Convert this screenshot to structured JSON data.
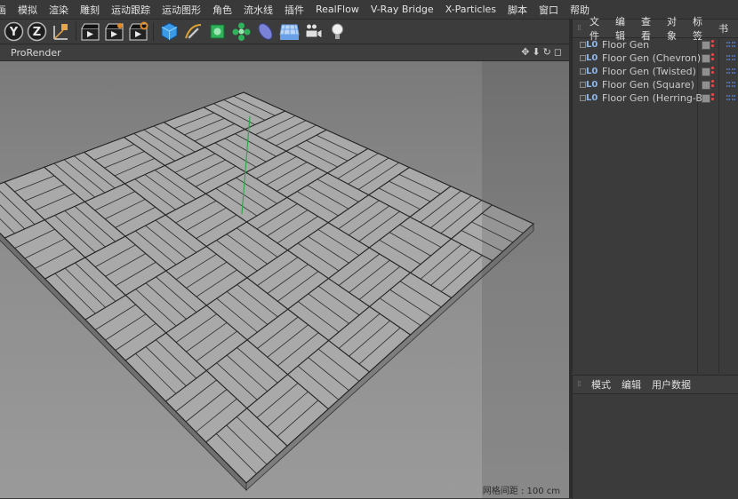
{
  "menu": [
    "画",
    "模拟",
    "渲染",
    "雕刻",
    "运动跟踪",
    "运动图形",
    "角色",
    "流水线",
    "插件",
    "RealFlow",
    "V-Ray Bridge",
    "X-Particles",
    "脚本",
    "窗口",
    "帮助"
  ],
  "toolbar": {
    "icons": [
      "y-axis-lock-icon",
      "z-axis-lock-icon",
      "coordinate-system-icon",
      "render-view-icon",
      "render-picture-viewer-icon",
      "render-settings-icon",
      "cube-primitive-icon",
      "pen-spline-icon",
      "subdivision-surface-icon",
      "cloner-icon",
      "deformer-icon",
      "floor-icon",
      "camera-icon",
      "light-icon"
    ]
  },
  "viewport": {
    "title": "ProRender",
    "nav_icons": [
      "move-view-icon",
      "zoom-view-icon",
      "rotate-view-icon",
      "maximize-view-icon"
    ],
    "grid_readout": "网格间距 : 100 cm"
  },
  "object_manager": {
    "tabs": [
      "文件",
      "编辑",
      "查看",
      "对象",
      "标签",
      "书"
    ],
    "objects": [
      {
        "icon": "L0",
        "name": "Floor Gen"
      },
      {
        "icon": "L0",
        "name": "Floor Gen (Chevron)"
      },
      {
        "icon": "L0",
        "name": "Floor Gen (Twisted)"
      },
      {
        "icon": "L0",
        "name": "Floor Gen (Square)"
      },
      {
        "icon": "L0",
        "name": "Floor Gen (Herring-B)"
      }
    ]
  },
  "attributes_manager": {
    "tabs": [
      "模式",
      "编辑",
      "用户数据"
    ]
  },
  "colors": {
    "accent_blue": "#8fb6e8",
    "status_red": "#e04848",
    "y_axis_green": "#2ea84a",
    "floor_tile": "#a9a9a9"
  }
}
